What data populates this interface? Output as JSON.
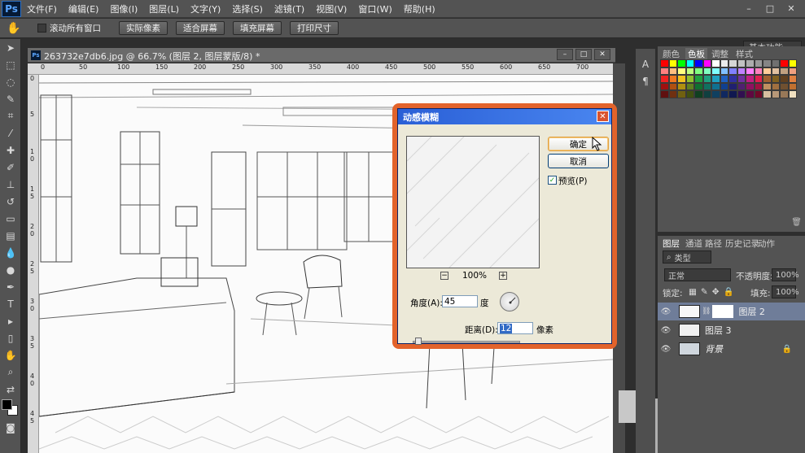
{
  "menubar": {
    "logo": "Ps",
    "items": [
      "文件(F)",
      "编辑(E)",
      "图像(I)",
      "图层(L)",
      "文字(Y)",
      "选择(S)",
      "滤镜(T)",
      "视图(V)",
      "窗口(W)",
      "帮助(H)"
    ],
    "window_controls": [
      "–",
      "□",
      "✕"
    ]
  },
  "options_bar": {
    "scroll_all_label": "滚动所有窗口",
    "buttons": [
      "实际像素",
      "适合屏幕",
      "填充屏幕",
      "打印尺寸"
    ],
    "workspace": "基本功能"
  },
  "document": {
    "title": "263732e7db6.jpg @ 66.7% (图层 2, 图层蒙版/8) *",
    "icon": "Ps",
    "ruler_top": [
      "0",
      "50",
      "100",
      "150",
      "200",
      "250",
      "300",
      "350",
      "400",
      "450",
      "500",
      "550",
      "600",
      "650",
      "700"
    ],
    "ruler_left": [
      "0",
      "5",
      "1\n0",
      "1\n5",
      "2\n0",
      "2\n5",
      "3\n0",
      "3\n5",
      "4\n0",
      "4\n5"
    ]
  },
  "color_panel": {
    "tabs": [
      "颜色",
      "色板",
      "调整",
      "样式"
    ],
    "active_tab": "色板",
    "swatch_colors": [
      "#ff0000",
      "#ffff00",
      "#00ff00",
      "#00ffff",
      "#0000ff",
      "#ff00ff",
      "#ffffff",
      "#ebebeb",
      "#d6d6d6",
      "#c2c2c2",
      "#adadad",
      "#999999",
      "#858585",
      "#707070",
      "#ff0000",
      "#ffff00",
      "#ff8080",
      "#ffbf80",
      "#ffff80",
      "#bfff80",
      "#80ff80",
      "#80ffbf",
      "#80ffff",
      "#80bfff",
      "#8080ff",
      "#bf80ff",
      "#ff80ff",
      "#ff80bf",
      "#ffcc99",
      "#e0c0a0",
      "#c0a080",
      "#f0a080",
      "#ee2222",
      "#f07820",
      "#f0c020",
      "#90c030",
      "#20a040",
      "#20a080",
      "#20a0c0",
      "#2060c0",
      "#3030a0",
      "#7030a0",
      "#c02080",
      "#e02050",
      "#a06030",
      "#806020",
      "#604020",
      "#e08040",
      "#a01010",
      "#b05010",
      "#b09010",
      "#608020",
      "#107030",
      "#107060",
      "#107090",
      "#104090",
      "#202070",
      "#502070",
      "#901060",
      "#a01040",
      "#c09060",
      "#a07040",
      "#705030",
      "#c07030",
      "#601010",
      "#703010",
      "#706010",
      "#405010",
      "#104020",
      "#104040",
      "#104060",
      "#102860",
      "#101850",
      "#301050",
      "#600840",
      "#700828",
      "#d8c0a0",
      "#b89878",
      "#987858",
      "#f0e0c0"
    ]
  },
  "layers_panel": {
    "tabs": [
      "图层",
      "通道",
      "路径",
      "历史记录",
      "动作"
    ],
    "filter": "类型",
    "blend_mode": "正常",
    "opacity_label": "不透明度:",
    "opacity_value": "100%",
    "lock_label": "锁定:",
    "fill_label": "填充:",
    "fill_value": "100%",
    "layers": [
      "图层 2",
      "图层 3",
      "背景"
    ]
  },
  "dialog": {
    "title": "动感模糊",
    "ok_label": "确定",
    "cancel_label": "取消",
    "preview_label": "预览(P)",
    "preview_checked": true,
    "zoom": "100%",
    "zoom_out": "−",
    "zoom_in": "+",
    "angle_label": "角度(A):",
    "angle_value": "45",
    "angle_unit": "度",
    "distance_label": "距离(D):",
    "distance_value": "12",
    "distance_unit": "像素"
  }
}
